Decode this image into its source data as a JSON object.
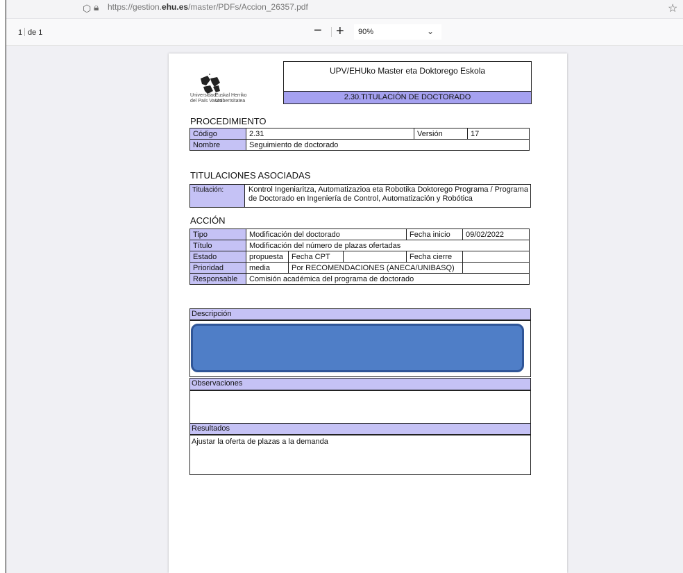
{
  "browser": {
    "url_prefix": "https://gestion.",
    "url_domain": "ehu.es",
    "url_path": "/master/PDFs/Accion_26357.pdf"
  },
  "pdf_toolbar": {
    "page_current": "1",
    "page_of": "de 1",
    "zoom_out": "−",
    "zoom_in": "+",
    "zoom_value": "90%",
    "zoom_chevron": "⌄"
  },
  "document": {
    "logo_caption_left": "Universidad\ndel País Vasco",
    "logo_caption_right": "Euskal Herriko\nUnibertsitatea",
    "header_title": "UPV/EHUko Master eta Doktorego Eskola",
    "header_subtitle": "2.30.TITULACIÓN DE DOCTORADO",
    "procedimiento": {
      "heading": "PROCEDIMIENTO",
      "codigo_label": "Código",
      "codigo_value": "2.31",
      "version_label": "Versión",
      "version_value": "17",
      "nombre_label": "Nombre",
      "nombre_value": "Seguimiento de doctorado"
    },
    "titulaciones": {
      "heading": "TITULACIONES ASOCIADAS",
      "titulacion_label": "Titulación:",
      "titulacion_value": "Kontrol Ingeniaritza, Automatizazioa eta Robotika Doktorego Programa / Programa de Doctorado en Ingeniería de Control, Automatización y Robótica"
    },
    "accion": {
      "heading": "ACCIÓN",
      "tipo_label": "Tipo",
      "tipo_value": "Modificación del doctorado",
      "fecha_inicio_label": "Fecha inicio",
      "fecha_inicio_value": "09/02/2022",
      "titulo_label": "Título",
      "titulo_value": "Modificación del número de plazas ofertadas",
      "estado_label": "Estado",
      "estado_value": "propuesta",
      "fecha_cpt_label": "Fecha CPT",
      "fecha_cpt_value": "",
      "fecha_cierre_label": "Fecha cierre",
      "fecha_cierre_value": "",
      "prioridad_label": "Prioridad",
      "prioridad_value": "media",
      "prioridad_motivo": "Por RECOMENDACIONES (ANECA/UNIBASQ)",
      "responsable_label": "Responsable",
      "responsable_value": "Comisión académica del programa de doctorado"
    },
    "descripcion_label": "Descripción",
    "observaciones_label": "Observaciones",
    "resultados_label": "Resultados",
    "resultados_value": "Ajustar la oferta de plazas a la demanda"
  },
  "colors": {
    "header_band": "#a5a1f0",
    "label_cell": "#c5c2f5",
    "redaction": "#4f7ec7"
  }
}
